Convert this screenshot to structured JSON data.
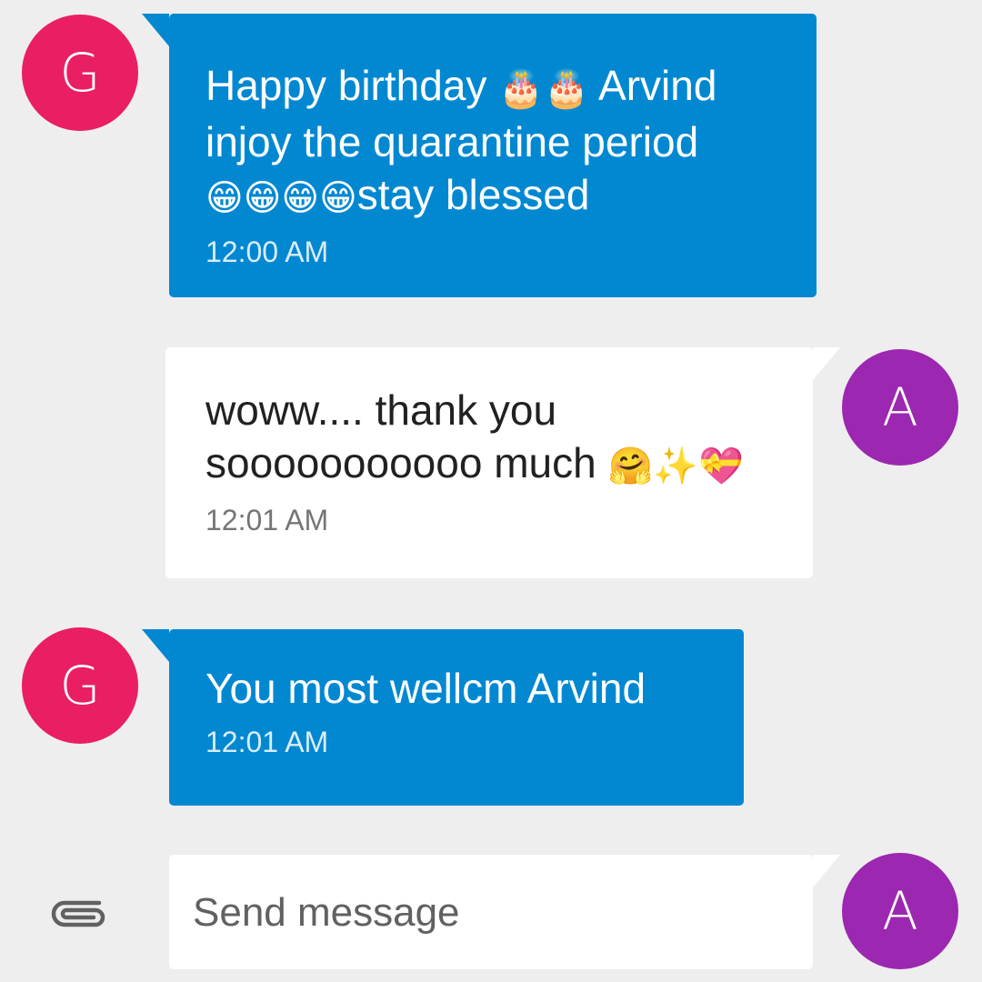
{
  "colors": {
    "background": "#eeeeee",
    "outgoing_bubble": "#0288d1",
    "incoming_bubble": "#ffffff",
    "avatar_g": "#e91e63",
    "avatar_a": "#9c27b0"
  },
  "messages": [
    {
      "sender": "G",
      "line1": "Happy birthday",
      "line1_emoji": "🎂🎂",
      "line1_end": "Arvind",
      "line2": "injoy the quarantine period",
      "line3_emoji": "😁😁😁😁",
      "line3": "stay blessed",
      "time": "12:00 AM"
    },
    {
      "sender": "A",
      "line1": "woww.... thank you",
      "line2": "sooooooooooo much",
      "line2_emoji": "🤗✨💝",
      "time": "12:01 AM"
    },
    {
      "sender": "G",
      "line1": "You most wellcm Arvind",
      "time": "12:01 AM"
    }
  ],
  "composer": {
    "placeholder": "Send message",
    "avatar": "A",
    "attach_icon": "paperclip-icon"
  }
}
